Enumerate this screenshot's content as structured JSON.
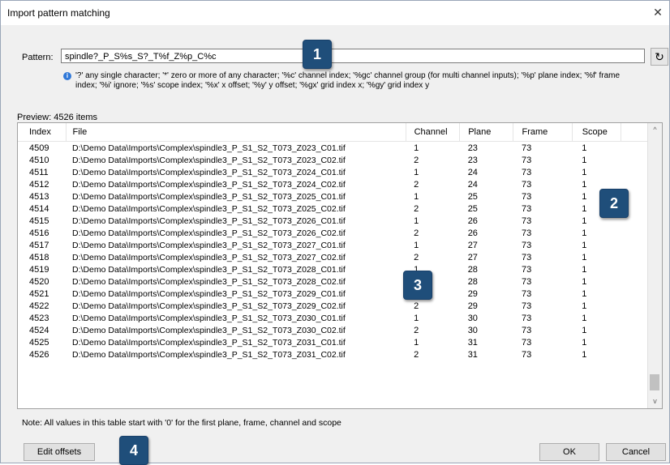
{
  "window": {
    "title": "Import pattern matching",
    "close_label": "✕"
  },
  "pattern": {
    "label": "Pattern:",
    "value": "spindle?_P_S%s_S?_T%f_Z%p_C%c",
    "refresh_label": "↻"
  },
  "hint": {
    "icon": "info-icon",
    "text": "'?' any single character; '*' zero or more of any character; '%c' channel index; '%gc' channel group (for multi channel inputs); '%p' plane index; '%f' frame index; '%i' ignore; '%s' scope index; '%x' x offset; '%y' y offset; '%gx' grid index x; '%gy' grid index y"
  },
  "preview": {
    "label": "Preview: 4526 items"
  },
  "table": {
    "columns": [
      "Index",
      "File",
      "Channel",
      "Plane",
      "Frame",
      "Scope"
    ],
    "rows": [
      [
        "4509",
        "D:\\Demo Data\\Imports\\Complex\\spindle3_P_S1_S2_T073_Z023_C01.tif",
        "1",
        "23",
        "73",
        "1"
      ],
      [
        "4510",
        "D:\\Demo Data\\Imports\\Complex\\spindle3_P_S1_S2_T073_Z023_C02.tif",
        "2",
        "23",
        "73",
        "1"
      ],
      [
        "4511",
        "D:\\Demo Data\\Imports\\Complex\\spindle3_P_S1_S2_T073_Z024_C01.tif",
        "1",
        "24",
        "73",
        "1"
      ],
      [
        "4512",
        "D:\\Demo Data\\Imports\\Complex\\spindle3_P_S1_S2_T073_Z024_C02.tif",
        "2",
        "24",
        "73",
        "1"
      ],
      [
        "4513",
        "D:\\Demo Data\\Imports\\Complex\\spindle3_P_S1_S2_T073_Z025_C01.tif",
        "1",
        "25",
        "73",
        "1"
      ],
      [
        "4514",
        "D:\\Demo Data\\Imports\\Complex\\spindle3_P_S1_S2_T073_Z025_C02.tif",
        "2",
        "25",
        "73",
        "1"
      ],
      [
        "4515",
        "D:\\Demo Data\\Imports\\Complex\\spindle3_P_S1_S2_T073_Z026_C01.tif",
        "1",
        "26",
        "73",
        "1"
      ],
      [
        "4516",
        "D:\\Demo Data\\Imports\\Complex\\spindle3_P_S1_S2_T073_Z026_C02.tif",
        "2",
        "26",
        "73",
        "1"
      ],
      [
        "4517",
        "D:\\Demo Data\\Imports\\Complex\\spindle3_P_S1_S2_T073_Z027_C01.tif",
        "1",
        "27",
        "73",
        "1"
      ],
      [
        "4518",
        "D:\\Demo Data\\Imports\\Complex\\spindle3_P_S1_S2_T073_Z027_C02.tif",
        "2",
        "27",
        "73",
        "1"
      ],
      [
        "4519",
        "D:\\Demo Data\\Imports\\Complex\\spindle3_P_S1_S2_T073_Z028_C01.tif",
        "1",
        "28",
        "73",
        "1"
      ],
      [
        "4520",
        "D:\\Demo Data\\Imports\\Complex\\spindle3_P_S1_S2_T073_Z028_C02.tif",
        "2",
        "28",
        "73",
        "1"
      ],
      [
        "4521",
        "D:\\Demo Data\\Imports\\Complex\\spindle3_P_S1_S2_T073_Z029_C01.tif",
        "1",
        "29",
        "73",
        "1"
      ],
      [
        "4522",
        "D:\\Demo Data\\Imports\\Complex\\spindle3_P_S1_S2_T073_Z029_C02.tif",
        "2",
        "29",
        "73",
        "1"
      ],
      [
        "4523",
        "D:\\Demo Data\\Imports\\Complex\\spindle3_P_S1_S2_T073_Z030_C01.tif",
        "1",
        "30",
        "73",
        "1"
      ],
      [
        "4524",
        "D:\\Demo Data\\Imports\\Complex\\spindle3_P_S1_S2_T073_Z030_C02.tif",
        "2",
        "30",
        "73",
        "1"
      ],
      [
        "4525",
        "D:\\Demo Data\\Imports\\Complex\\spindle3_P_S1_S2_T073_Z031_C01.tif",
        "1",
        "31",
        "73",
        "1"
      ],
      [
        "4526",
        "D:\\Demo Data\\Imports\\Complex\\spindle3_P_S1_S2_T073_Z031_C02.tif",
        "2",
        "31",
        "73",
        "1"
      ]
    ]
  },
  "scrollbar": {
    "up_label": "^",
    "down_label": "v"
  },
  "note": {
    "text": "Note: All values in this table start with '0' for the first plane, frame, channel and scope"
  },
  "buttons": {
    "edit_offsets": "Edit offsets",
    "ok": "OK",
    "cancel": "Cancel"
  },
  "badges": [
    "1",
    "2",
    "3",
    "4"
  ],
  "colors": {
    "badge": "#1f4e7a",
    "info": "#3078d8"
  }
}
